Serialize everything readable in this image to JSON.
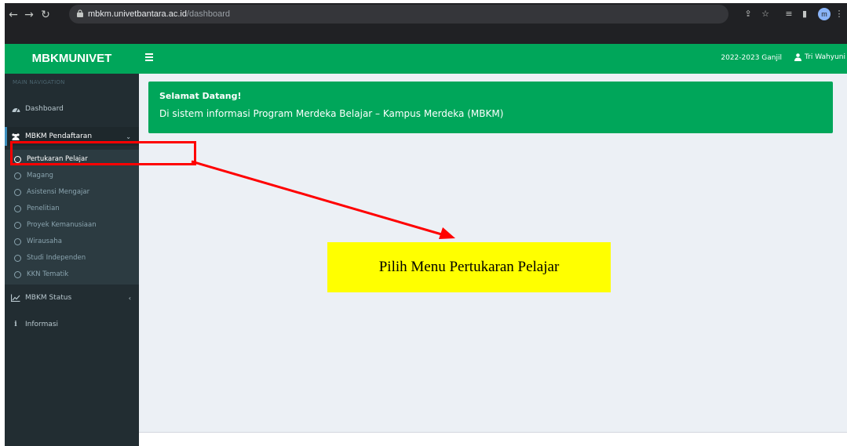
{
  "browser": {
    "url_host": "mbkm.univetbantara.ac.id",
    "url_path": "/dashboard",
    "profile_initial": "m"
  },
  "header": {
    "brand_prefix": "MBKM",
    "brand_suffix": "UNIVET",
    "semester": "2022-2023 Ganjil",
    "user_name": "Tri Wahyuni"
  },
  "sidebar": {
    "nav_header": "MAIN NAVIGATION",
    "dashboard": "Dashboard",
    "pendaftaran": "MBKM Pendaftaran",
    "sub_items": [
      "Pertukaran Pelajar",
      "Magang",
      "Asistensi Mengajar",
      "Penelitian",
      "Proyek Kemanusiaan",
      "Wirausaha",
      "Studi Independen",
      "KKN Tematik"
    ],
    "status": "MBKM Status",
    "informasi": "Informasi"
  },
  "welcome": {
    "title": "Selamat Datang!",
    "text": "Di sistem informasi Program Merdeka Belajar – Kampus Merdeka (MBKM)"
  },
  "annotation": {
    "callout": "Pilih Menu Pertukaran Pelajar"
  },
  "colors": {
    "brand_green": "#00a65a",
    "sidebar_bg": "#222d32",
    "annotation_red": "#ff0000",
    "callout_yellow": "#ffff00"
  }
}
